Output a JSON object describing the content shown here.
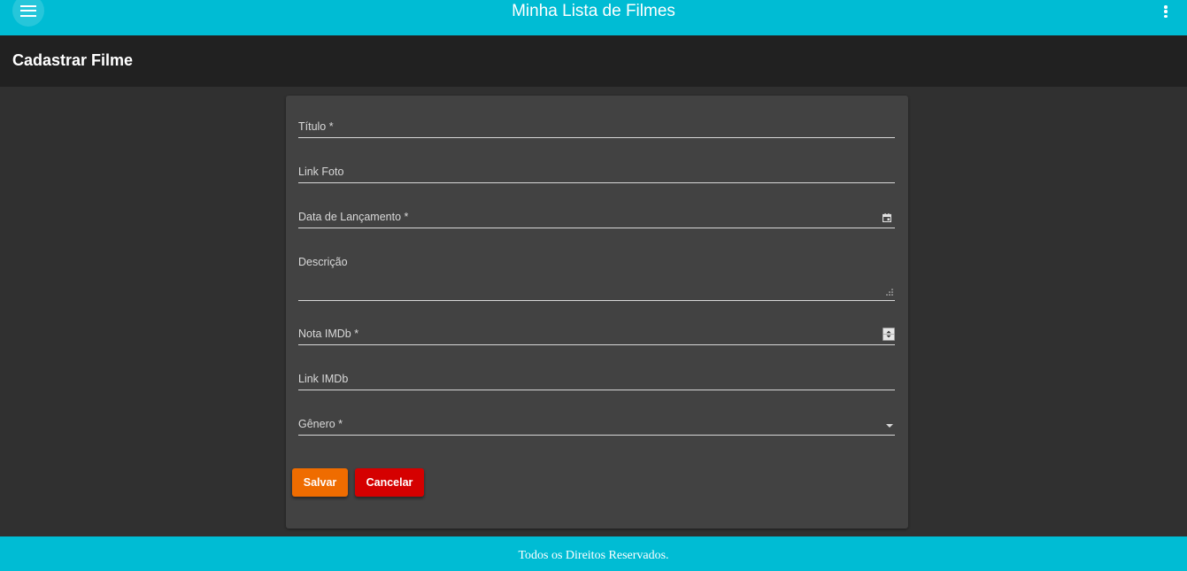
{
  "toolbar": {
    "menu_icon": "menu-icon",
    "title": "Minha Lista de Filmes",
    "more_icon": "more-vertical-icon",
    "accent_color": "#00bcd4"
  },
  "page": {
    "title": "Cadastrar Filme"
  },
  "form": {
    "fields": [
      {
        "label": "Título *",
        "type": "text",
        "value": ""
      },
      {
        "label": "Link Foto",
        "type": "text",
        "value": ""
      },
      {
        "label": "Data de Lançamento *",
        "type": "date",
        "value": "",
        "icon": "calendar-icon"
      },
      {
        "label": "Descrição",
        "type": "textarea",
        "value": "",
        "icon": "resize-handle-icon"
      },
      {
        "label": "Nota IMDb *",
        "type": "number",
        "value": "",
        "icon": "number-stepper-icon"
      },
      {
        "label": "Link IMDb",
        "type": "text",
        "value": ""
      },
      {
        "label": "Gênero *",
        "type": "select",
        "value": "",
        "icon": "dropdown-arrow-icon"
      }
    ],
    "save_label": "Salvar",
    "cancel_label": "Cancelar",
    "save_color": "#ef6c00",
    "cancel_color": "#d50000"
  },
  "footer": {
    "text": "Todos os Direitos Reservados."
  }
}
